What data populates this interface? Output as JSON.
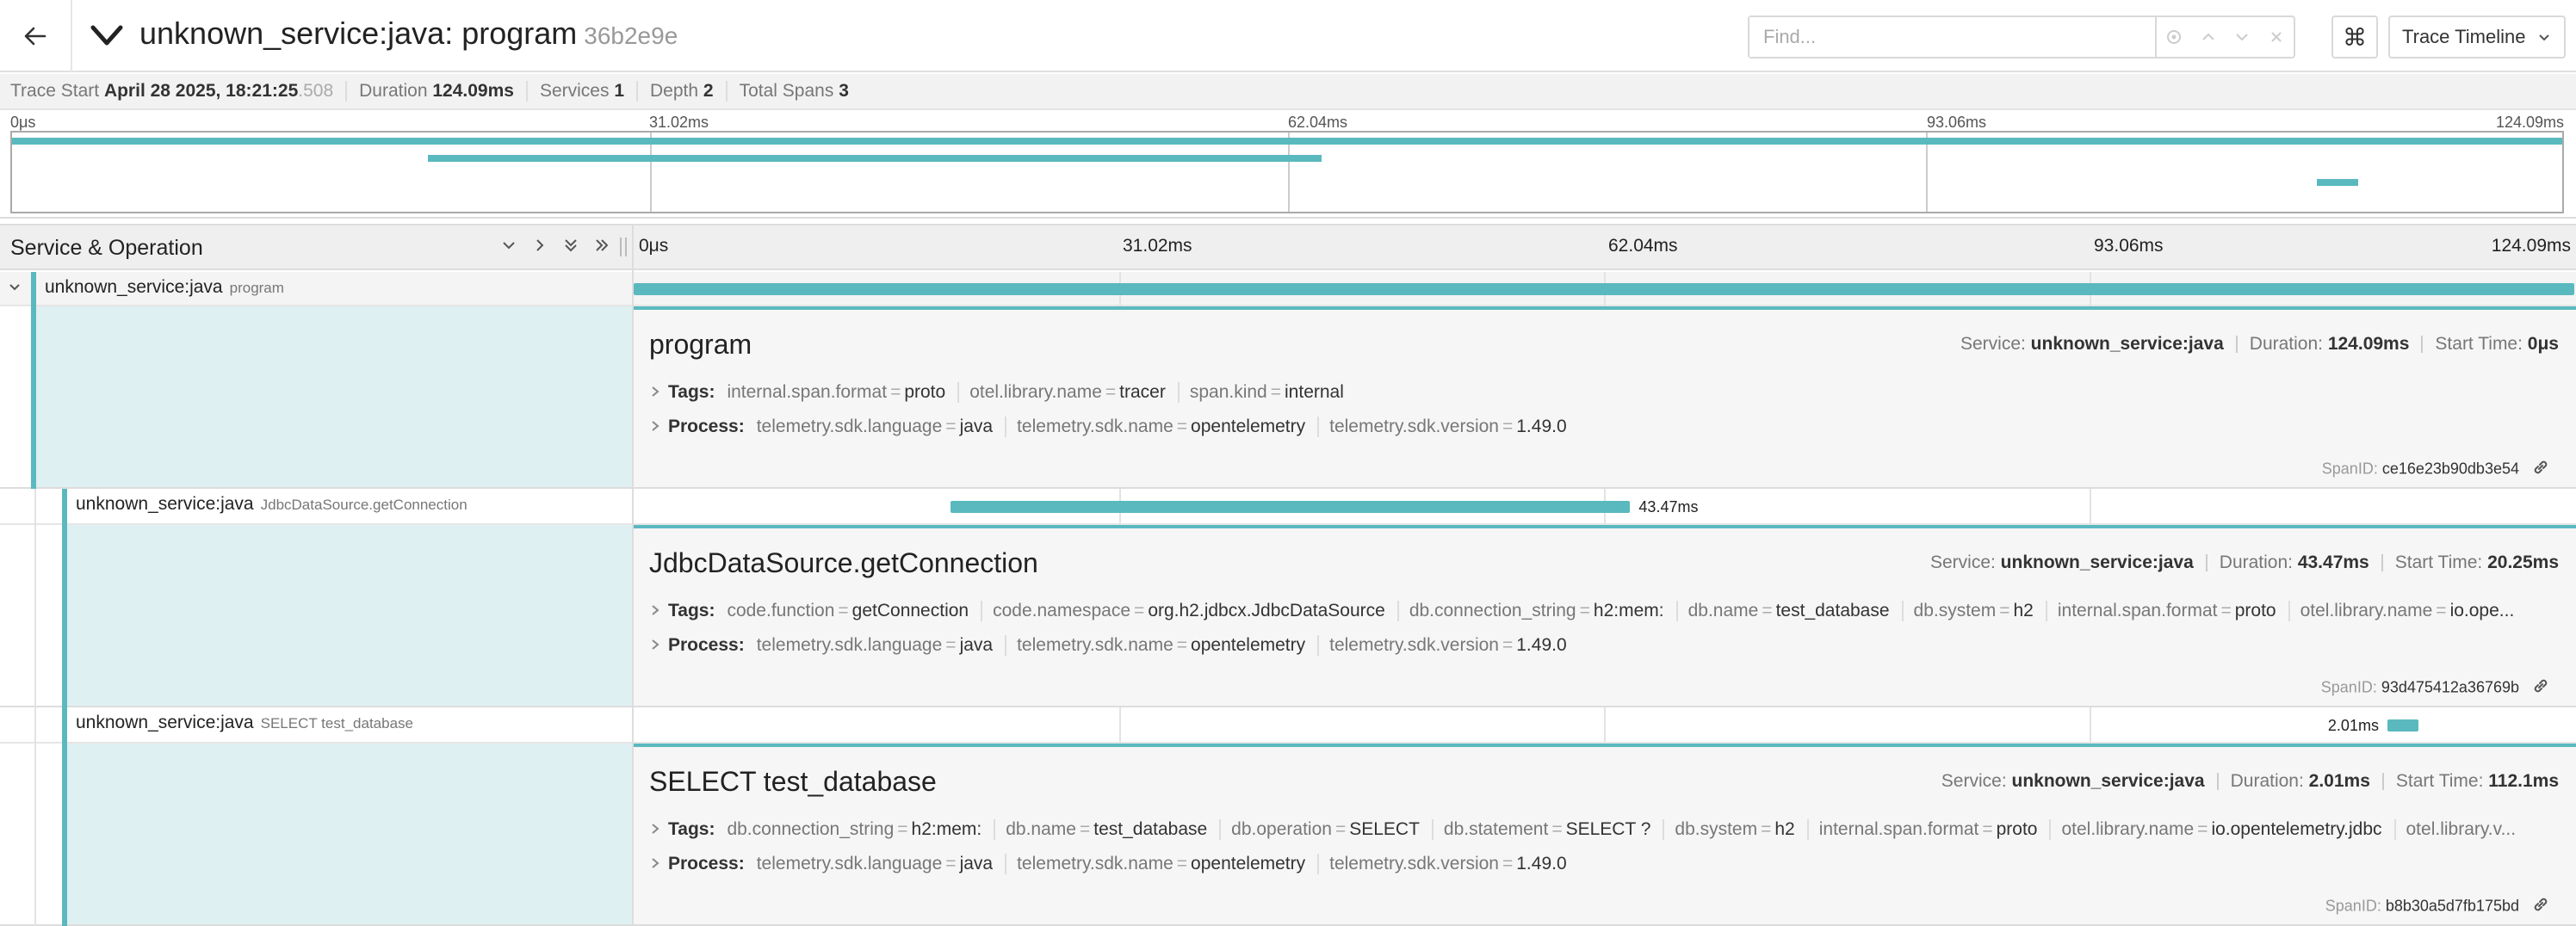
{
  "header": {
    "title": "unknown_service:java: program",
    "trace_id": "36b2e9e",
    "find_placeholder": "Find...",
    "keyboard_symbol": "⌘",
    "view_mode": "Trace Timeline"
  },
  "summary": {
    "trace_start_label": "Trace Start",
    "trace_start_value": "April 28 2025, 18:21:25",
    "trace_start_ms": ".508",
    "duration_label": "Duration",
    "duration_value": "124.09ms",
    "services_label": "Services",
    "services_value": "1",
    "depth_label": "Depth",
    "depth_value": "2",
    "total_spans_label": "Total Spans",
    "total_spans_value": "3"
  },
  "ticks": [
    "0μs",
    "31.02ms",
    "62.04ms",
    "93.06ms",
    "124.09ms"
  ],
  "timeline_header": {
    "title": "Service & Operation"
  },
  "spans": [
    {
      "service": "unknown_service:java",
      "operation": "program",
      "start_fraction": 0.0,
      "duration_fraction": 1.0,
      "duration_label": "",
      "detail": {
        "title": "program",
        "service_label": "Service:",
        "service_value": "unknown_service:java",
        "duration_label": "Duration:",
        "duration_value": "124.09ms",
        "start_label": "Start Time:",
        "start_value": "0μs",
        "tags_label": "Tags:",
        "tags": [
          {
            "k": "internal.span.format",
            "v": "proto"
          },
          {
            "k": "otel.library.name",
            "v": "tracer"
          },
          {
            "k": "span.kind",
            "v": "internal"
          }
        ],
        "process_label": "Process:",
        "process": [
          {
            "k": "telemetry.sdk.language",
            "v": "java"
          },
          {
            "k": "telemetry.sdk.name",
            "v": "opentelemetry"
          },
          {
            "k": "telemetry.sdk.version",
            "v": "1.49.0"
          }
        ],
        "span_id_label": "SpanID:",
        "span_id": "ce16e23b90db3e54"
      }
    },
    {
      "service": "unknown_service:java",
      "operation": "JdbcDataSource.getConnection",
      "start_fraction": 0.1632,
      "duration_fraction": 0.3503,
      "duration_label": "43.47ms",
      "detail": {
        "title": "JdbcDataSource.getConnection",
        "service_label": "Service:",
        "service_value": "unknown_service:java",
        "duration_label": "Duration:",
        "duration_value": "43.47ms",
        "start_label": "Start Time:",
        "start_value": "20.25ms",
        "tags_label": "Tags:",
        "tags": [
          {
            "k": "code.function",
            "v": "getConnection"
          },
          {
            "k": "code.namespace",
            "v": "org.h2.jdbcx.JdbcDataSource"
          },
          {
            "k": "db.connection_string",
            "v": "h2:mem:"
          },
          {
            "k": "db.name",
            "v": "test_database"
          },
          {
            "k": "db.system",
            "v": "h2"
          },
          {
            "k": "internal.span.format",
            "v": "proto"
          },
          {
            "k": "otel.library.name",
            "v": "io.ope..."
          }
        ],
        "process_label": "Process:",
        "process": [
          {
            "k": "telemetry.sdk.language",
            "v": "java"
          },
          {
            "k": "telemetry.sdk.name",
            "v": "opentelemetry"
          },
          {
            "k": "telemetry.sdk.version",
            "v": "1.49.0"
          }
        ],
        "span_id_label": "SpanID:",
        "span_id": "93d475412a36769b"
      }
    },
    {
      "service": "unknown_service:java",
      "operation": "SELECT test_database",
      "start_fraction": 0.9037,
      "duration_fraction": 0.0162,
      "duration_label": "2.01ms",
      "detail": {
        "title": "SELECT test_database",
        "service_label": "Service:",
        "service_value": "unknown_service:java",
        "duration_label": "Duration:",
        "duration_value": "2.01ms",
        "start_label": "Start Time:",
        "start_value": "112.1ms",
        "tags_label": "Tags:",
        "tags": [
          {
            "k": "db.connection_string",
            "v": "h2:mem:"
          },
          {
            "k": "db.name",
            "v": "test_database"
          },
          {
            "k": "db.operation",
            "v": "SELECT"
          },
          {
            "k": "db.statement",
            "v": "SELECT ?"
          },
          {
            "k": "db.system",
            "v": "h2"
          },
          {
            "k": "internal.span.format",
            "v": "proto"
          },
          {
            "k": "otel.library.name",
            "v": "io.opentelemetry.jdbc"
          },
          {
            "k": "otel.library.v...",
            "v": ""
          }
        ],
        "process_label": "Process:",
        "process": [
          {
            "k": "telemetry.sdk.language",
            "v": "java"
          },
          {
            "k": "telemetry.sdk.name",
            "v": "opentelemetry"
          },
          {
            "k": "telemetry.sdk.version",
            "v": "1.49.0"
          }
        ],
        "span_id_label": "SpanID:",
        "span_id": "b8b30a5d7fb175bd"
      }
    }
  ],
  "colors": {
    "accent": "#5ab9bf",
    "detail_bg": "#dff0f2"
  }
}
